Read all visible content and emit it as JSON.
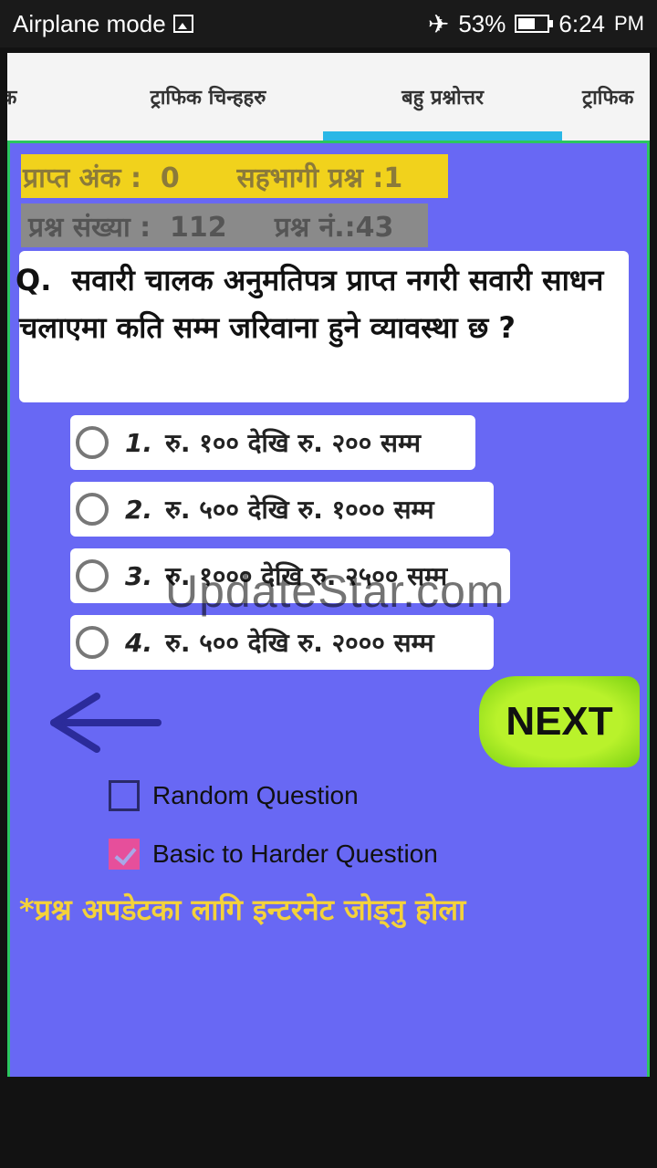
{
  "status_bar": {
    "mode": "Airplane mode",
    "battery": "53%",
    "time": "6:24",
    "ampm": "PM"
  },
  "tabs": [
    {
      "label": "क"
    },
    {
      "label": "ट्राफिक चिन्हहरु"
    },
    {
      "label": "बहु प्रश्नोत्तर"
    },
    {
      "label": "ट्राफिक"
    }
  ],
  "score": {
    "text": "प्राप्त अंक :  0      सहभागी प्रश्न :1"
  },
  "counts": {
    "text": "प्रश्न संख्या :  112     प्रश्न नं.:43"
  },
  "question": {
    "prefix": "Q.",
    "text": "सवारी चालक अनुमतिपत्र प्राप्त नगरी सवारी साधन चलाएमा कति सम्म जरिवाना हुने व्यावस्था छ ?"
  },
  "options": [
    {
      "num": "1.",
      "text": "रु. १०० देखि रु. २०० सम्म"
    },
    {
      "num": "2.",
      "text": "रु. ५०० देखि रु. १००० सम्म"
    },
    {
      "num": "3.",
      "text": "रु. १००० देखि रु. २५०० सम्म"
    },
    {
      "num": "4.",
      "text": "रु. ५०० देखि रु. २००० सम्म"
    }
  ],
  "watermark": "UpdateStar.com",
  "next_label": "NEXT",
  "checkboxes": [
    {
      "label": "Random Question",
      "checked": false
    },
    {
      "label": "Basic to Harder Question",
      "checked": true
    }
  ],
  "notice": "*प्रश्न अपडेटका लागि इन्टरनेट जोड्नु होला",
  "colors": {
    "background": "#6868f4",
    "score_bg": "#f1d21c",
    "tab_indicator": "#2ab7e6",
    "next_button": "#b9f22b",
    "checkbox_checked": "#e64f9b"
  }
}
